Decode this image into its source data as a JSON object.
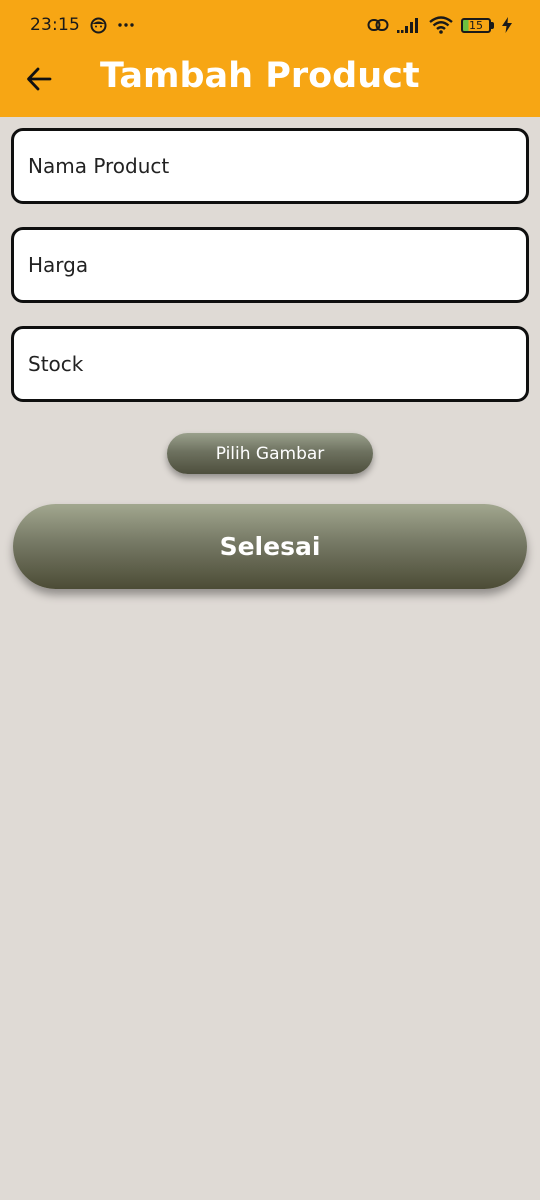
{
  "status_bar": {
    "time": "23:15",
    "battery_level": "15",
    "icons": [
      "face-icon",
      "more-dots-icon",
      "link-icon",
      "signal-icon",
      "wifi-icon",
      "battery-icon",
      "charging-bolt-icon"
    ]
  },
  "app_bar": {
    "title": "Tambah Product",
    "back_icon": "arrow-left-icon",
    "background": "#f7a614"
  },
  "form": {
    "name_placeholder": "Nama Product",
    "price_placeholder": "Harga",
    "stock_placeholder": "Stock",
    "name_value": "",
    "price_value": "",
    "stock_value": ""
  },
  "buttons": {
    "choose_image_label": "Pilih Gambar",
    "finish_label": "Selesai"
  },
  "colors": {
    "accent": "#f7a614",
    "background": "#dfdad5",
    "button": "#6e7260"
  }
}
